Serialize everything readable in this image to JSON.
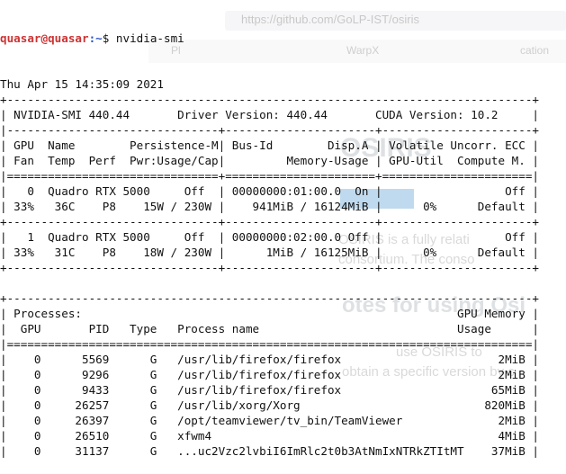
{
  "terminal": {
    "prompt_user": "quasar@quasar",
    "prompt_path": ":~",
    "prompt_symbol": "$ ",
    "command": "nvidia-smi",
    "lines": [
      "Thu Apr 15 14:35:09 2021",
      "+-----------------------------------------------------------------------------+",
      "| NVIDIA-SMI 440.44       Driver Version: 440.44       CUDA Version: 10.2     |",
      "|-------------------------------+----------------------+----------------------+",
      "| GPU  Name        Persistence-M| Bus-Id        Disp.A | Volatile Uncorr. ECC |",
      "| Fan  Temp  Perf  Pwr:Usage/Cap|         Memory-Usage | GPU-Util  Compute M. |",
      "|===============================+======================+======================|",
      "|   0  Quadro RTX 5000     Off  | 00000000:01:00.0  On |                  Off |",
      "| 33%   36C    P8    15W / 230W |    941MiB / 16124MiB |      0%      Default |",
      "+-------------------------------+----------------------+----------------------+",
      "|   1  Quadro RTX 5000     Off  | 00000000:02:00.0 Off |                  Off |",
      "| 33%   31C    P8    18W / 230W |      1MiB / 16125MiB |      0%      Default |",
      "+-------------------------------+----------------------+----------------------+",
      "",
      "+-----------------------------------------------------------------------------+",
      "| Processes:                                                       GPU Memory |",
      "|  GPU       PID   Type   Process name                             Usage      |",
      "|=============================================================================|",
      "|    0      5569      G   /usr/lib/firefox/firefox                       2MiB |",
      "|    0      9296      G   /usr/lib/firefox/firefox                       2MiB |",
      "|    0      9433      G   /usr/lib/firefox/firefox                      65MiB |",
      "|    0     26257      G   /usr/lib/xorg/Xorg                           820MiB |",
      "|    0     26397      G   /opt/teamviewer/tv_bin/TeamViewer              2MiB |",
      "|    0     26510      G   xfwm4                                          4MiB |",
      "|    0     31137      G   ...uc2Vzc2lvbiI6ImRlc2t0b3AtNmIxNTRkZTItMT    37MiB |"
    ]
  },
  "background_browser": {
    "url": "https://github.com/GoLP-IST/osiris",
    "tabs": [
      "Pl",
      "WarpX",
      "cation"
    ],
    "heading": "OSIRIS",
    "paragraph": [
      "OSIRIS is a fully relati",
      "consortium. The conso"
    ],
    "subheading": "otes for using Osi",
    "paragraph2": [
      "use OSIRIS to",
      "obtain a specific version by c"
    ]
  }
}
